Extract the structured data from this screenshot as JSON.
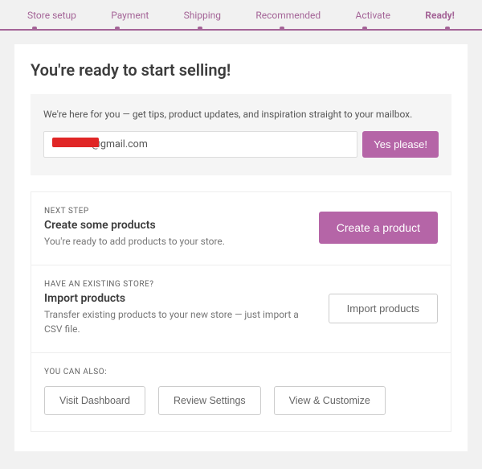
{
  "nav": {
    "items": [
      "Store setup",
      "Payment",
      "Shipping",
      "Recommended",
      "Activate",
      "Ready!"
    ],
    "active_index": 5
  },
  "title": "You're ready to start selling!",
  "mailbox": {
    "blurb": "We're here for you — get tips, product updates, and inspiration straight to your mailbox.",
    "email_visible_suffix": "s@gmail.com",
    "button": "Yes please!"
  },
  "steps": {
    "create": {
      "eyebrow": "NEXT STEP",
      "title": "Create some products",
      "desc": "You're ready to add products to your store.",
      "button": "Create a product"
    },
    "import": {
      "eyebrow": "HAVE AN EXISTING STORE?",
      "title": "Import products",
      "desc": "Transfer existing products to your new store — just import a CSV file.",
      "button": "Import products"
    }
  },
  "also": {
    "eyebrow": "YOU CAN ALSO:",
    "buttons": [
      "Visit Dashboard",
      "Review Settings",
      "View & Customize"
    ]
  }
}
